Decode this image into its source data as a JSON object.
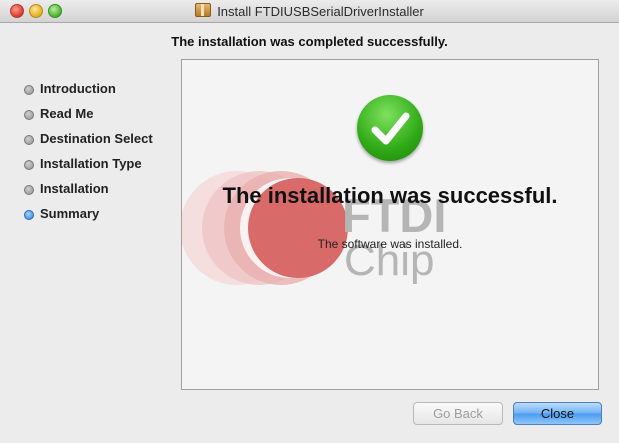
{
  "window": {
    "title": "Install FTDIUSBSerialDriverInstaller",
    "heading": "The installation was completed successfully."
  },
  "sidebar": {
    "items": [
      {
        "label": "Introduction",
        "active": false
      },
      {
        "label": "Read Me",
        "active": false
      },
      {
        "label": "Destination Select",
        "active": false
      },
      {
        "label": "Installation Type",
        "active": false
      },
      {
        "label": "Installation",
        "active": false
      },
      {
        "label": "Summary",
        "active": true
      }
    ]
  },
  "content": {
    "success_title": "The installation was successful.",
    "success_subtitle": "The software was installed.",
    "logo_text": [
      "FTDI",
      "Chip"
    ],
    "icon": "checkmark-icon"
  },
  "buttons": {
    "back_label": "Go Back",
    "close_label": "Close"
  },
  "colors": {
    "accent": "#4a9bef",
    "success": "#2fa916",
    "logo_red": "#d96a6a"
  }
}
